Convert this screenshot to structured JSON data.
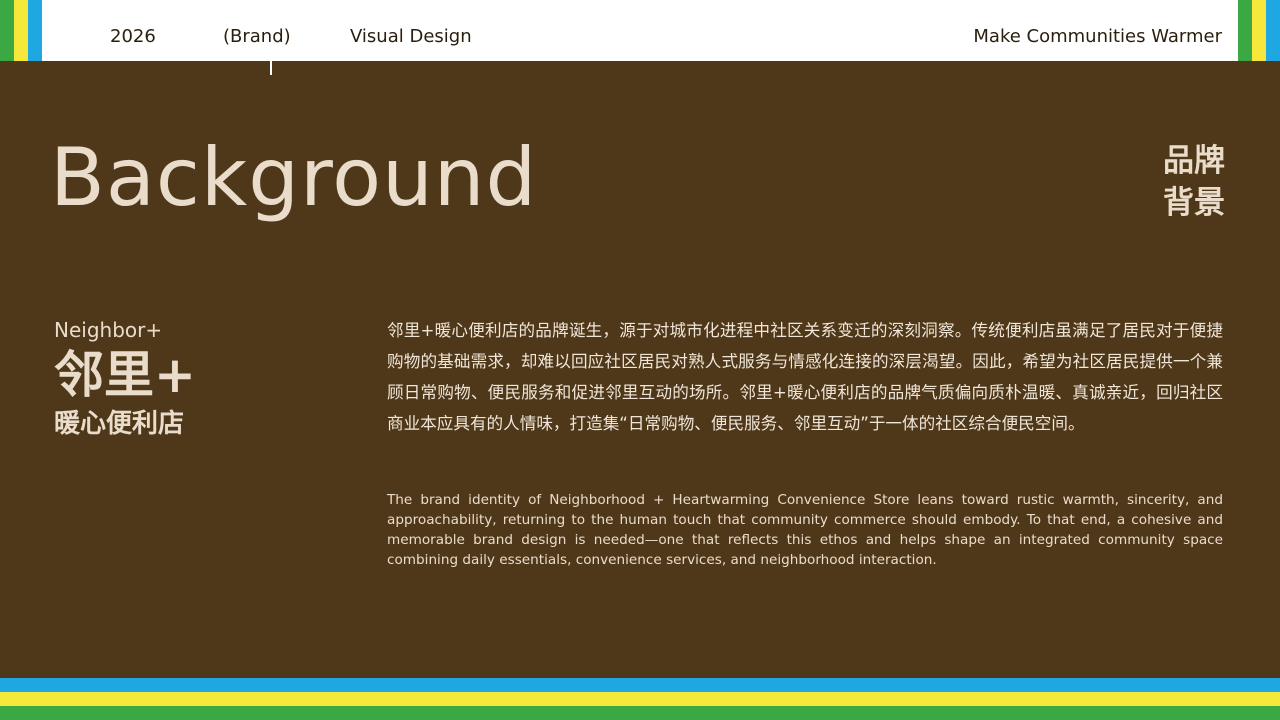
{
  "header": {
    "year": "2026",
    "brand": "(Brand)",
    "section": "Visual Design",
    "tagline": "Make Communities Warmer"
  },
  "title": {
    "en": "Background",
    "cn_line1": "品牌",
    "cn_line2": "背景"
  },
  "brand_block": {
    "en": "Neighbor+",
    "cn": "邻里+",
    "cn_sub": "暖心便利店"
  },
  "body": {
    "cn": "邻里+暖心便利店的品牌诞生，源于对城市化进程中社区关系变迁的深刻洞察。传统便利店虽满足了居民对于便捷购物的基础需求，却难以回应社区居民对熟人式服务与情感化连接的深层渴望。因此，希望为社区居民提供一个兼顾日常购物、便民服务和促进邻里互动的场所。邻里+暖心便利店的品牌气质偏向质朴温暖、真诚亲近，回归社区商业本应具有的人情味，打造集“日常购物、便民服务、邻里互动”于一体的社区综合便民空间。",
    "en": "The brand identity of Neighborhood + Heartwarming Convenience Store leans toward rustic warmth, sincerity, and approachability, returning to the human touch that community commerce should embody. To that end, a cohesive and memorable brand design is needed—one that reflects this ethos and helps shape an integrated community space combining daily essentials, convenience services, and neighborhood interaction."
  },
  "colors": {
    "background": "#4f3819",
    "text_light": "#e9dccb",
    "blue": "#1ea7e1",
    "yellow": "#f6e83a",
    "green": "#3aa843",
    "white": "#ffffff"
  }
}
